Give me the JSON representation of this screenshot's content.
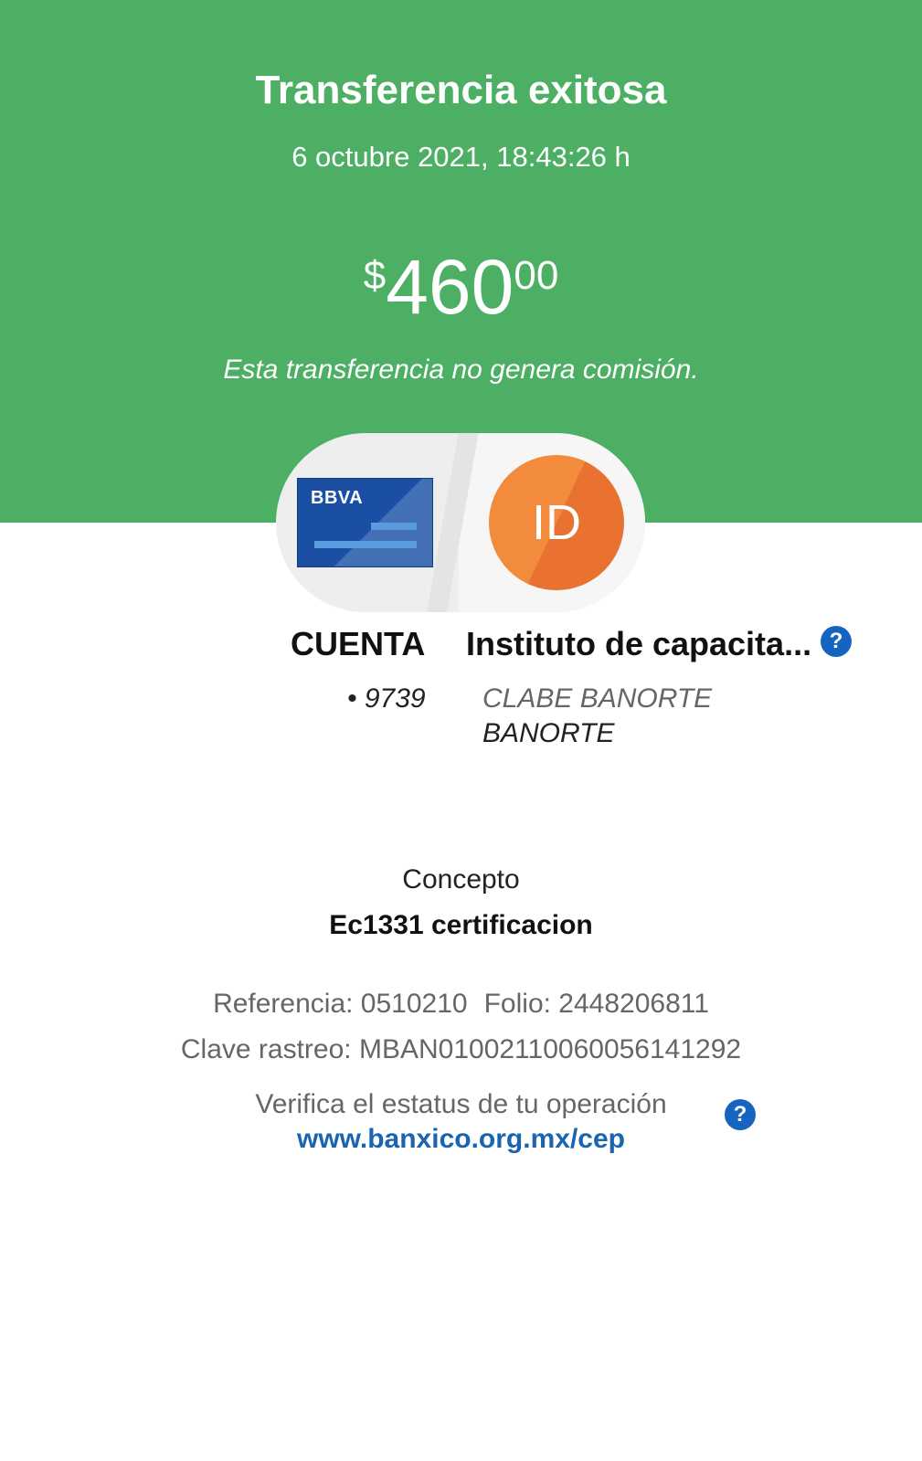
{
  "header": {
    "title": "Transferencia exitosa",
    "datetime": "6 octubre 2021, 18:43:26 h",
    "amount": {
      "currency": "$",
      "integer": "460",
      "decimals": "00"
    },
    "fee_note": "Esta transferencia no genera comisión."
  },
  "origin": {
    "card_brand": "BBVA",
    "label": "CUENTA",
    "account_mask": "• 9739"
  },
  "recipient": {
    "initials": "ID",
    "name": "Instituto de capacita...",
    "account_type": "CLABE BANORTE",
    "bank": "BANORTE",
    "help_icon": "question-mark"
  },
  "concept": {
    "label": "Concepto",
    "value": "Ec1331 certificacion"
  },
  "details": {
    "reference": "Referencia: 0510210",
    "folio": "Folio: 2448206811",
    "tracking_key": "Clave rastreo: MBAN01002110060056141292"
  },
  "verify": {
    "text": "Verifica el estatus de tu operación",
    "link": "www.banxico.org.mx/cep",
    "help_icon": "question-mark"
  },
  "colors": {
    "header_green": "#4caf63",
    "link_blue": "#1a64b0",
    "help_blue": "#1565c0",
    "avatar_orange": "#f28c3c",
    "card_blue": "#1a4fa3"
  }
}
